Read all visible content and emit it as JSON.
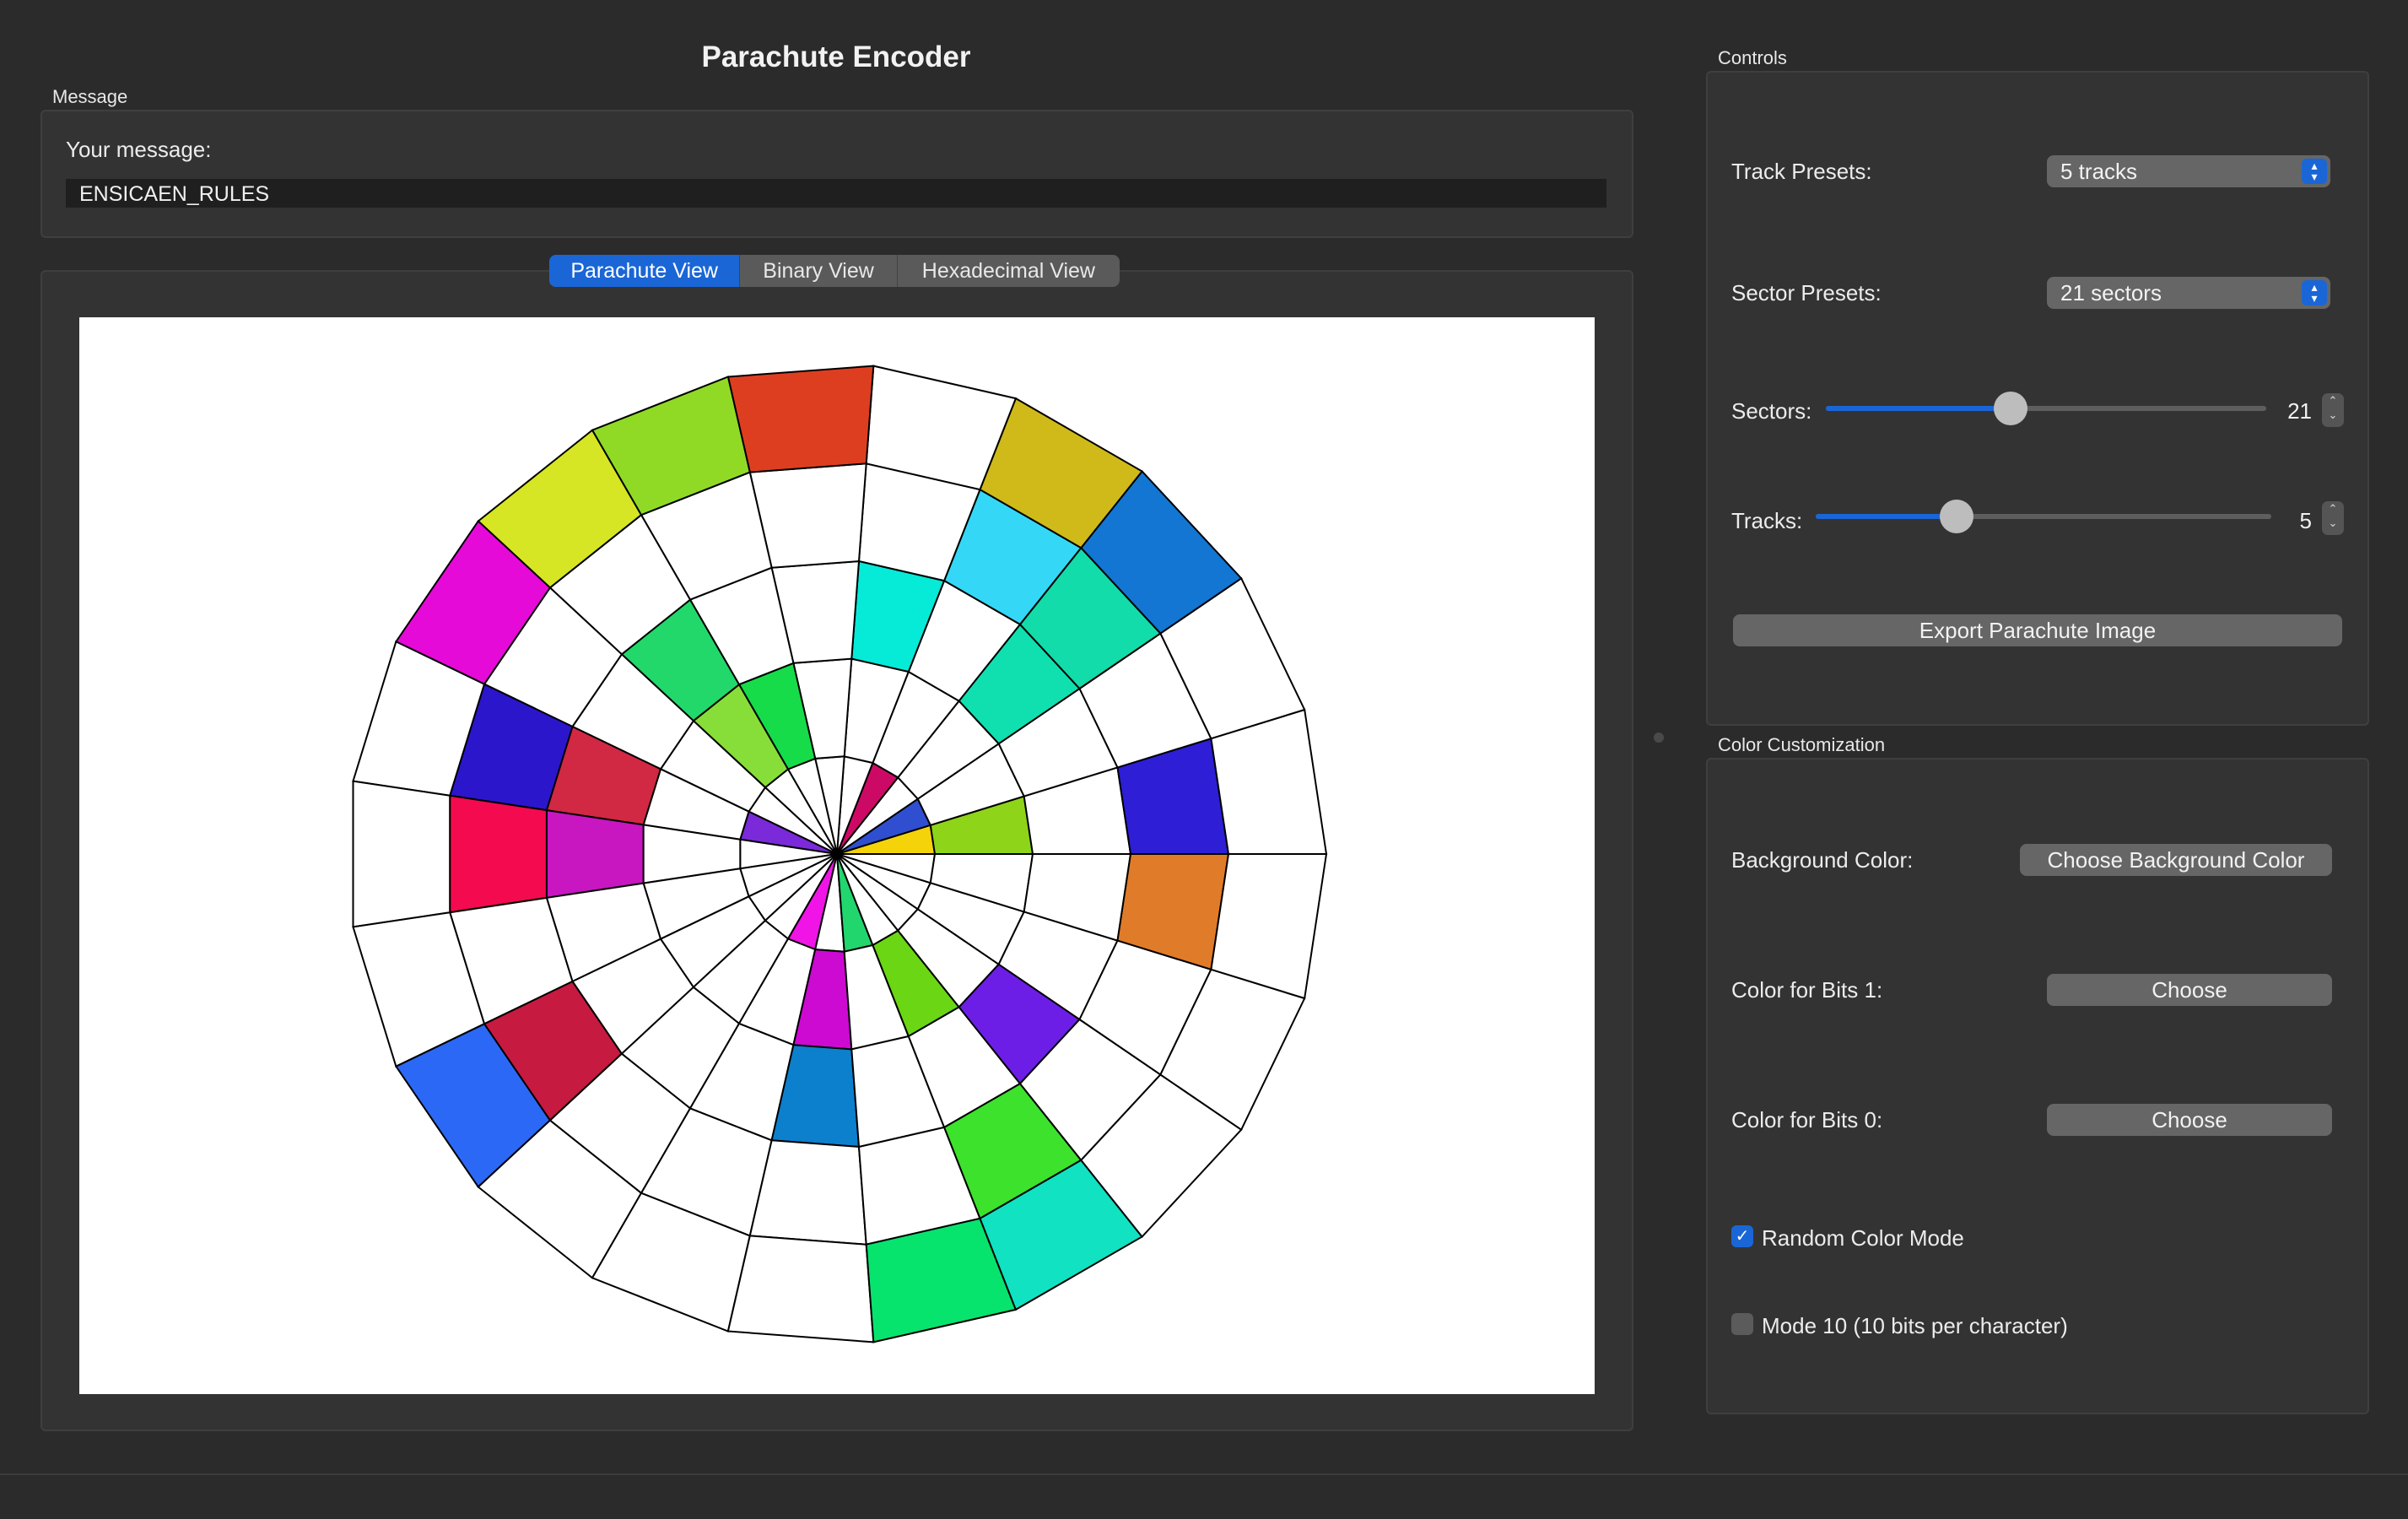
{
  "app": {
    "title": "Parachute Encoder"
  },
  "message_group": {
    "label": "Message",
    "field_label": "Your message:",
    "value": "ENSICAEN_RULES"
  },
  "tabs": [
    {
      "label": "Parachute View",
      "active": true
    },
    {
      "label": "Binary View",
      "active": false
    },
    {
      "label": "Hexadecimal View",
      "active": false
    }
  ],
  "controls": {
    "label": "Controls",
    "track_presets_label": "Track Presets:",
    "track_presets_value": "5 tracks",
    "sector_presets_label": "Sector Presets:",
    "sector_presets_value": "21 sectors",
    "sectors_label": "Sectors:",
    "sectors_value": "21",
    "sectors_fraction": 0.42,
    "tracks_label": "Tracks:",
    "tracks_value": "5",
    "tracks_fraction": 0.31,
    "export_label": "Export Parachute Image"
  },
  "color_customization": {
    "label": "Color Customization",
    "background_label": "Background Color:",
    "background_button": "Choose Background Color",
    "bits1_label": "Color for Bits 1:",
    "bits1_button": "Choose",
    "bits0_label": "Color for Bits 0:",
    "bits0_button": "Choose",
    "random_mode_label": "Random Color Mode",
    "random_mode_checked": true,
    "mode10_label": "Mode 10 (10 bits per character)",
    "mode10_checked": false
  },
  "parachute": {
    "sectors": 21,
    "tracks": 5,
    "background": "#ffffff",
    "outline": "#000000",
    "cells": [
      {
        "track": 0,
        "sector": 0,
        "color": "#f5d30a"
      },
      {
        "track": 0,
        "sector": 1,
        "color": "#2f4fd0"
      },
      {
        "track": 0,
        "sector": 3,
        "color": "#cc0a66"
      },
      {
        "track": 0,
        "sector": 9,
        "color": "#7a2ad8"
      },
      {
        "track": 0,
        "sector": 14,
        "color": "#f014e6"
      },
      {
        "track": 0,
        "sector": 16,
        "color": "#22d66e"
      },
      {
        "track": 1,
        "sector": 0,
        "color": "#8ed418"
      },
      {
        "track": 1,
        "sector": 6,
        "color": "#16dc4a"
      },
      {
        "track": 1,
        "sector": 7,
        "color": "#88de38"
      },
      {
        "track": 1,
        "sector": 15,
        "color": "#cc0ad2"
      },
      {
        "track": 1,
        "sector": 17,
        "color": "#6ad614"
      },
      {
        "track": 2,
        "sector": 2,
        "color": "#10e0b0"
      },
      {
        "track": 2,
        "sector": 4,
        "color": "#06ead8"
      },
      {
        "track": 2,
        "sector": 7,
        "color": "#22d86a"
      },
      {
        "track": 2,
        "sector": 9,
        "color": "#d12844"
      },
      {
        "track": 2,
        "sector": 10,
        "color": "#c816c0"
      },
      {
        "track": 2,
        "sector": 15,
        "color": "#0c80cc"
      },
      {
        "track": 2,
        "sector": 18,
        "color": "#6c1ee6"
      },
      {
        "track": 3,
        "sector": 0,
        "color": "#2e1ed6"
      },
      {
        "track": 3,
        "sector": 2,
        "color": "#12dcaa"
      },
      {
        "track": 3,
        "sector": 3,
        "color": "#34d8f6"
      },
      {
        "track": 3,
        "sector": 9,
        "color": "#2c16cc"
      },
      {
        "track": 3,
        "sector": 10,
        "color": "#f40a4e"
      },
      {
        "track": 3,
        "sector": 12,
        "color": "#c61a40"
      },
      {
        "track": 3,
        "sector": 17,
        "color": "#3ce22c"
      },
      {
        "track": 3,
        "sector": 20,
        "color": "#e07b2a"
      },
      {
        "track": 4,
        "sector": 2,
        "color": "#1276d2"
      },
      {
        "track": 4,
        "sector": 3,
        "color": "#cfba1a"
      },
      {
        "track": 4,
        "sector": 5,
        "color": "#de3e20"
      },
      {
        "track": 4,
        "sector": 6,
        "color": "#90da26"
      },
      {
        "track": 4,
        "sector": 7,
        "color": "#d6e624"
      },
      {
        "track": 4,
        "sector": 8,
        "color": "#e60ad8"
      },
      {
        "track": 4,
        "sector": 12,
        "color": "#2c68f6"
      },
      {
        "track": 4,
        "sector": 16,
        "color": "#06e46e"
      },
      {
        "track": 4,
        "sector": 17,
        "color": "#10e2c2"
      }
    ]
  }
}
